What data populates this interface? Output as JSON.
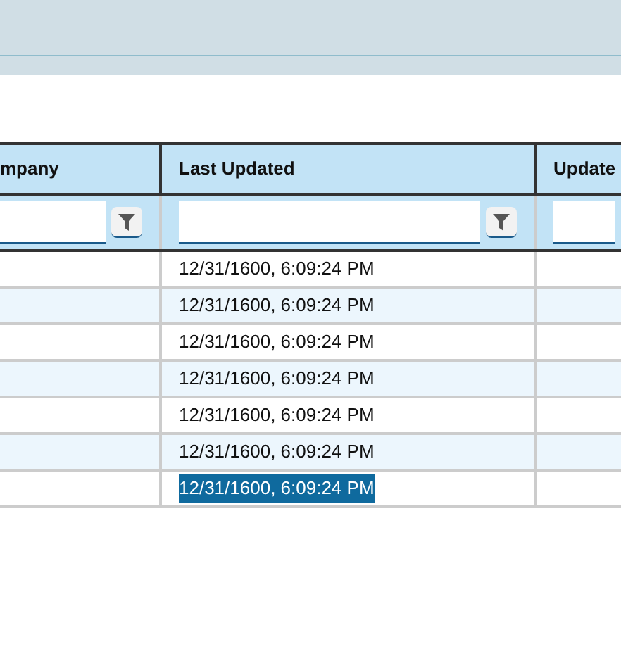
{
  "table": {
    "columns": [
      {
        "label": "mpany"
      },
      {
        "label": "Last Updated"
      },
      {
        "label": "Update"
      }
    ],
    "rows": [
      {
        "cells": [
          "",
          "12/31/1600, 6:09:24 PM",
          ""
        ],
        "highlighted": false
      },
      {
        "cells": [
          "",
          "12/31/1600, 6:09:24 PM",
          ""
        ],
        "highlighted": false
      },
      {
        "cells": [
          "",
          "12/31/1600, 6:09:24 PM",
          ""
        ],
        "highlighted": false
      },
      {
        "cells": [
          "",
          "12/31/1600, 6:09:24 PM",
          ""
        ],
        "highlighted": false
      },
      {
        "cells": [
          "",
          "12/31/1600, 6:09:24 PM",
          ""
        ],
        "highlighted": false
      },
      {
        "cells": [
          "",
          "12/31/1600, 6:09:24 PM",
          ""
        ],
        "highlighted": false
      },
      {
        "cells": [
          "",
          "12/31/1600, 6:09:24 PM",
          ""
        ],
        "highlighted": true
      }
    ]
  }
}
